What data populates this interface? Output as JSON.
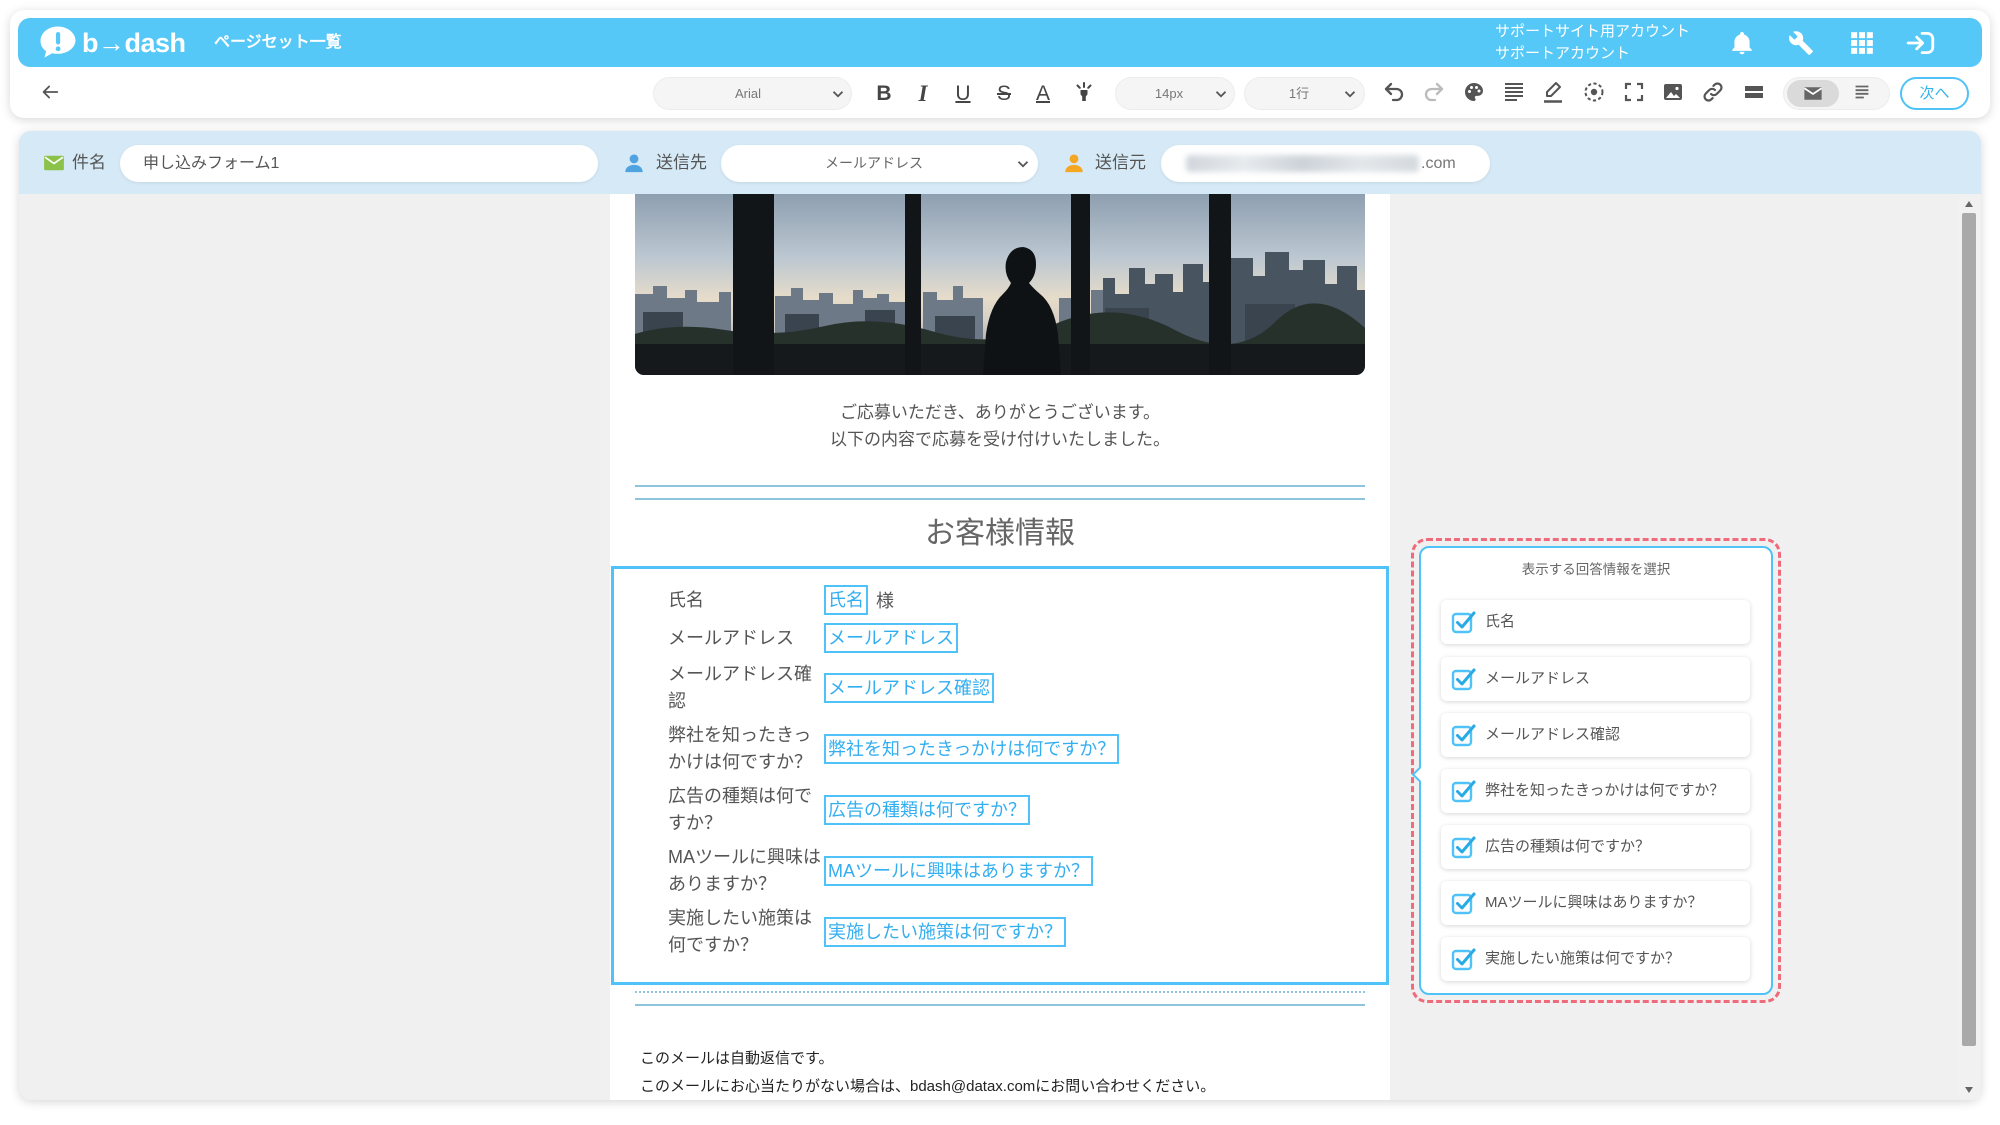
{
  "colors": {
    "accent": "#4fc3f7",
    "header_bg": "#56c8f7",
    "compose_bg": "#d5e9f6",
    "selection_outline": "#ef6b7b",
    "rule": "#8fc4de",
    "subject_icon": "#8bc34a",
    "to_icon": "#4fa3e0",
    "from_icon": "#f5a623"
  },
  "header": {
    "logo_text": "b→dash",
    "page_title": "ページセット一覧",
    "account_line1": "サポートサイト用アカウント",
    "account_line2": "サポートアカウント",
    "icons": [
      "bell-icon",
      "wrench-icon",
      "apps-grid-icon",
      "logout-icon"
    ]
  },
  "toolbar": {
    "font_family": "Arial",
    "format_glyphs": {
      "bold": "B",
      "italic": "I",
      "underline": "U",
      "strike": "S",
      "font_color": "A"
    },
    "font_size": "14px",
    "line_height": "1行",
    "next_label": "次へ",
    "view_mode": "mail",
    "icons": [
      "arrow-left-icon",
      "highlight-icon",
      "undo-icon",
      "redo-icon",
      "palette-icon",
      "align-icon",
      "border-pen-icon",
      "target-icon",
      "fullscreen-icon",
      "image-icon",
      "link-icon",
      "divider-icon",
      "mail-view-icon",
      "text-view-icon"
    ]
  },
  "compose": {
    "subject_label": "件名",
    "subject_value": "申し込みフォーム1",
    "to_label": "送信先",
    "to_value": "メールアドレス",
    "from_label": "送信元",
    "from_value_visible": ".com"
  },
  "email": {
    "intro_line1": "ご応募いただき、ありがとうございます。",
    "intro_line2": "以下の内容で応募を受け付けいたしました。",
    "section_title": "お客様情報",
    "rows": [
      {
        "label": "氏名",
        "value": "氏名",
        "suffix": "様"
      },
      {
        "label": "メールアドレス",
        "value": "メールアドレス"
      },
      {
        "label": "メールアドレス確認",
        "value": "メールアドレス確認"
      },
      {
        "label": "弊社を知ったきっかけは何ですか？",
        "value": "弊社を知ったきっかけは何ですか？"
      },
      {
        "label": "広告の種類は何ですか？",
        "value": "広告の種類は何ですか？"
      },
      {
        "label": "MAツールに興味はありますか？",
        "value": "MAツールに興味はありますか？"
      },
      {
        "label": "実施したい施策は何ですか？",
        "value": "実施したい施策は何ですか？"
      }
    ],
    "footer_line1": "このメールは自動返信です。",
    "footer_line2": "このメールにお心当たりがない場合は、bdash@datax.comにお問い合わせください。"
  },
  "answer_panel": {
    "title": "表示する回答情報を選択",
    "items": [
      {
        "label": "氏名",
        "checked": true
      },
      {
        "label": "メールアドレス",
        "checked": true
      },
      {
        "label": "メールアドレス確認",
        "checked": true
      },
      {
        "label": "弊社を知ったきっかけは何ですか？",
        "checked": true
      },
      {
        "label": "広告の種類は何ですか？",
        "checked": true
      },
      {
        "label": "MAツールに興味はありますか？",
        "checked": true
      },
      {
        "label": "実施したい施策は何ですか？",
        "checked": true
      }
    ]
  }
}
